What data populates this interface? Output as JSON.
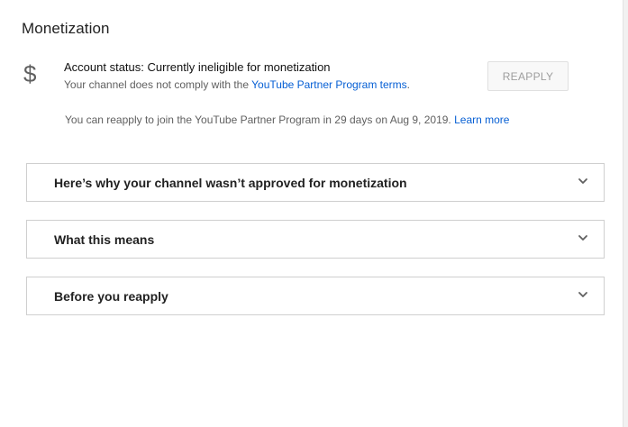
{
  "page": {
    "title": "Monetization"
  },
  "account_status": {
    "icon": "dollar-icon",
    "icon_glyph": "$",
    "title": "Account status: Currently ineligible for monetization",
    "desc_prefix": "Your channel does not comply with the ",
    "terms_link": "YouTube Partner Program terms",
    "desc_suffix": "."
  },
  "reapply": {
    "button_label": "REAPPLY",
    "info_text": "You can reapply to join the YouTube Partner Program in 29 days on Aug 9, 2019. ",
    "learn_more": "Learn more"
  },
  "accordions": [
    {
      "label": "Here’s why your channel wasn’t approved for monetization",
      "icon": "chevron-down-icon"
    },
    {
      "label": "What this means",
      "icon": "chevron-down-icon"
    },
    {
      "label": "Before you reapply",
      "icon": "chevron-down-icon"
    }
  ],
  "colors": {
    "link": "#065fd4",
    "text_primary": "#212121",
    "text_secondary": "#606060",
    "border": "#cfcfcf",
    "disabled_button_text": "#9e9e9e"
  }
}
